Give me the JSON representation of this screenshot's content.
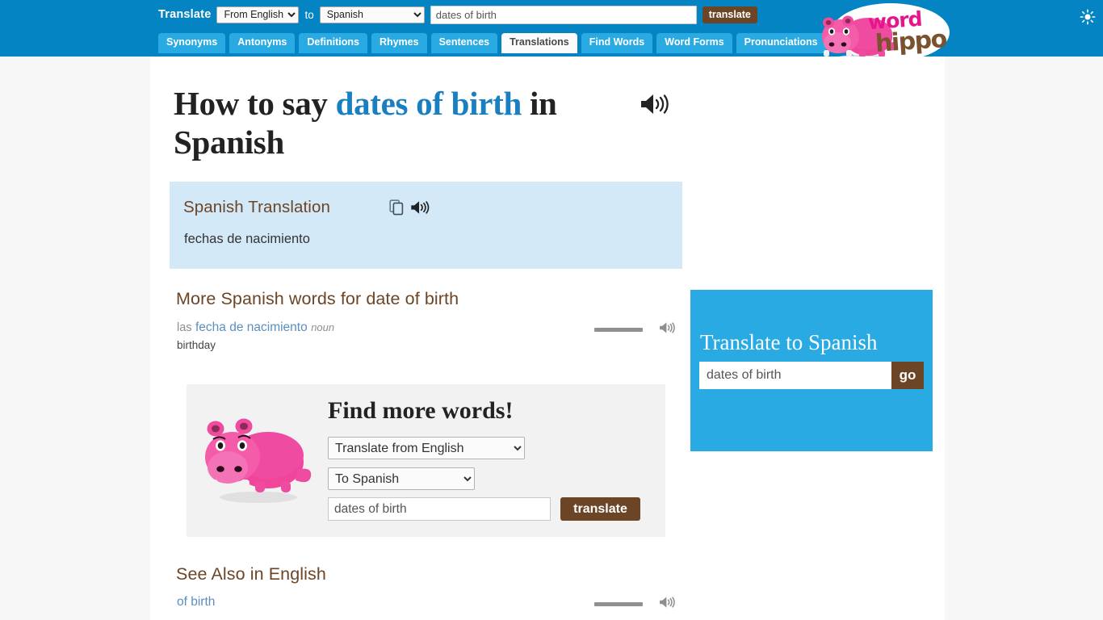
{
  "header": {
    "translate_label": "Translate",
    "from_selected": "From English",
    "from_options": [
      "From English"
    ],
    "to_word": "to",
    "to_selected": "Spanish",
    "to_options": [
      "Spanish"
    ],
    "search_value": "dates of birth",
    "translate_button": "translate",
    "theme_toggle_icon": "sun-icon",
    "logo_word": "word",
    "logo_hippo": "hippo"
  },
  "tabs": [
    {
      "label": "Synonyms",
      "active": false
    },
    {
      "label": "Antonyms",
      "active": false
    },
    {
      "label": "Definitions",
      "active": false
    },
    {
      "label": "Rhymes",
      "active": false
    },
    {
      "label": "Sentences",
      "active": false
    },
    {
      "label": "Translations",
      "active": true
    },
    {
      "label": "Find Words",
      "active": false
    },
    {
      "label": "Word Forms",
      "active": false
    },
    {
      "label": "Pronunciations",
      "active": false
    }
  ],
  "main": {
    "title_prefix": "How to say",
    "title_term": "dates of birth",
    "title_suffix": "in Spanish",
    "title_speaker_icon": "speaker-icon",
    "translation_box": {
      "heading": "Spanish Translation",
      "copy_icon": "copy-icon",
      "speaker_icon": "speaker-icon",
      "value": "fechas de nacimiento"
    },
    "more_words": {
      "heading": "More Spanish words for date of birth",
      "rows": [
        {
          "article": "las",
          "word": "fecha de nacimiento",
          "pos": "noun",
          "definition": "birthday"
        }
      ]
    },
    "find_more_words": {
      "heading": "Find more words!",
      "from_selected": "Translate from English",
      "to_selected": "To Spanish",
      "input_value": "dates of birth",
      "button_label": "translate"
    },
    "see_also": {
      "heading": "See Also in English",
      "rows": [
        {
          "word": "of birth"
        }
      ]
    }
  },
  "sidebar": {
    "widget": {
      "heading": "Translate to Spanish",
      "input_value": "dates of birth",
      "button_label": "go"
    }
  },
  "colors": {
    "header_blue": "#0484c2",
    "tab_blue": "#29aae2",
    "brown": "#6b4526",
    "link_blue": "#5b8fc0",
    "title_highlight": "#1a7fc1",
    "translation_box_bg": "#d4e9f7",
    "page_bg": "#f7f7f7",
    "pink": "#e5168b"
  }
}
